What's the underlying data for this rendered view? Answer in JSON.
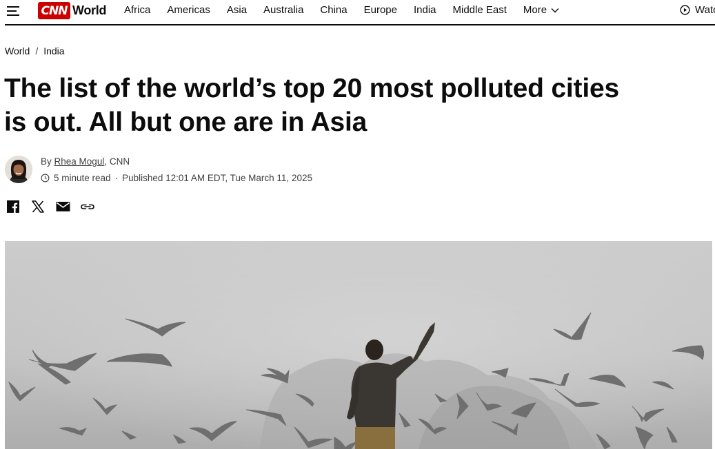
{
  "header": {
    "logo_text": "CNN",
    "edition_label": "World",
    "nav_items": [
      "Africa",
      "Americas",
      "Asia",
      "Australia",
      "China",
      "Europe",
      "India",
      "Middle East"
    ],
    "more_label": "More",
    "watch_label": "Watch",
    "icons": {
      "menu": "hamburger-menu-icon",
      "more": "chevron-down-icon",
      "watch": "play-circle-icon"
    }
  },
  "breadcrumb": {
    "items": [
      "World",
      "India"
    ],
    "separator": "/"
  },
  "article": {
    "headline_line1": "The list of the world’s top 20 most polluted cities",
    "headline_line2": "is out. All but one are in Asia",
    "byline": {
      "prefix": "By",
      "author": "Rhea Mogul",
      "outlet": ", CNN"
    },
    "meta": {
      "read_time": "5 minute read",
      "separator": "·",
      "published": "Published 12:01 AM EDT, Tue March 11, 2025"
    },
    "share_icons": [
      "facebook-icon",
      "x-icon",
      "email-icon",
      "link-icon"
    ]
  },
  "hero_image": {
    "description_colors": {
      "sky": "#cfcfcf",
      "fog": "#b9b9b9",
      "birds": "#6d6d6d"
    }
  },
  "colors": {
    "brand_red": "#cc0000",
    "text": "#0c0c0c",
    "meta_text": "#404040"
  }
}
